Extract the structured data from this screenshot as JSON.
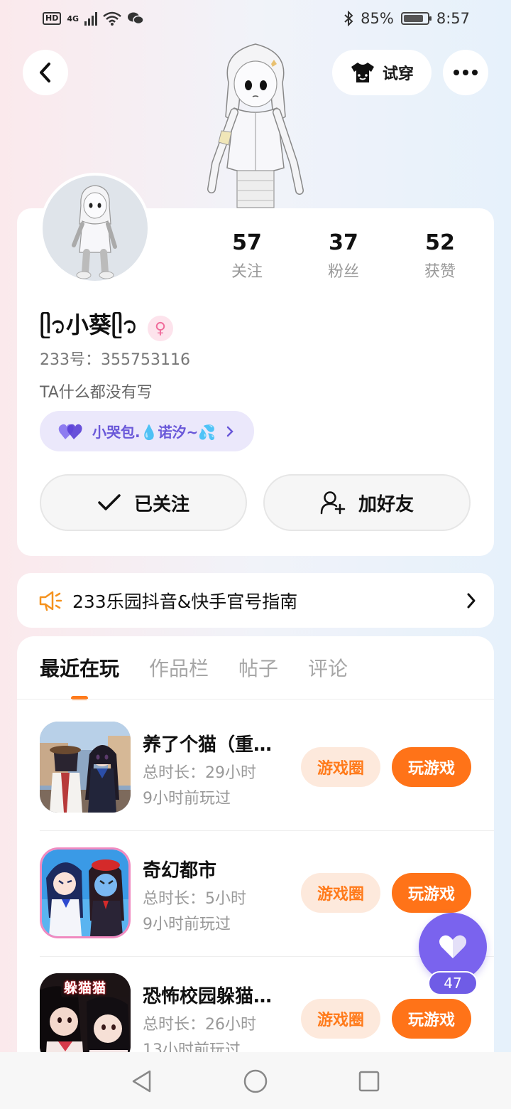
{
  "status_bar": {
    "left_badge": "HD",
    "network": "4G",
    "battery_percent": "85%",
    "battery_level": 0.85,
    "time": "8:57"
  },
  "header": {
    "back_icon": "chevron-left-icon",
    "tryon_label": "试穿",
    "tryon_icon": "tshirt-icon",
    "more_icon": "more-dots-icon"
  },
  "profile": {
    "stats": [
      {
        "value": "57",
        "label": "关注"
      },
      {
        "value": "37",
        "label": "粉丝"
      },
      {
        "value": "52",
        "label": "获赞"
      }
    ],
    "username": "ᥫ᭡小葵ᥫ᭡",
    "gender_symbol": "♀",
    "uid_label": "233号：",
    "uid_value": "355753116",
    "bio": "TA什么都没有写",
    "family_tag": "小哭包.💧诺汐~💦",
    "follow_btn": "已关注",
    "add_friend_btn": "加好友"
  },
  "notice": {
    "text": "233乐园抖音&快手官号指南"
  },
  "tabs": [
    {
      "label": "最近在玩",
      "active": true
    },
    {
      "label": "作品栏",
      "active": false
    },
    {
      "label": "帖子",
      "active": false
    },
    {
      "label": "评论",
      "active": false
    }
  ],
  "games": [
    {
      "name": "养了个猫（重…",
      "duration": "总时长：29小时",
      "last_played": "9小时前玩过",
      "circle_btn": "游戏圈",
      "play_btn": "玩游戏"
    },
    {
      "name": "奇幻都市",
      "duration": "总时长：5小时",
      "last_played": "9小时前玩过",
      "circle_btn": "游戏圈",
      "play_btn": "玩游戏"
    },
    {
      "name": "恐怖校园躲猫…",
      "duration": "总时长：26小时",
      "last_played": "13小时前玩过",
      "circle_btn": "游戏圈",
      "play_btn": "玩游戏",
      "icon_text": "躲猫猫"
    }
  ],
  "like": {
    "count": "47"
  },
  "colors": {
    "accent_orange": "#ff7318",
    "accent_purple": "#7a63ee"
  }
}
